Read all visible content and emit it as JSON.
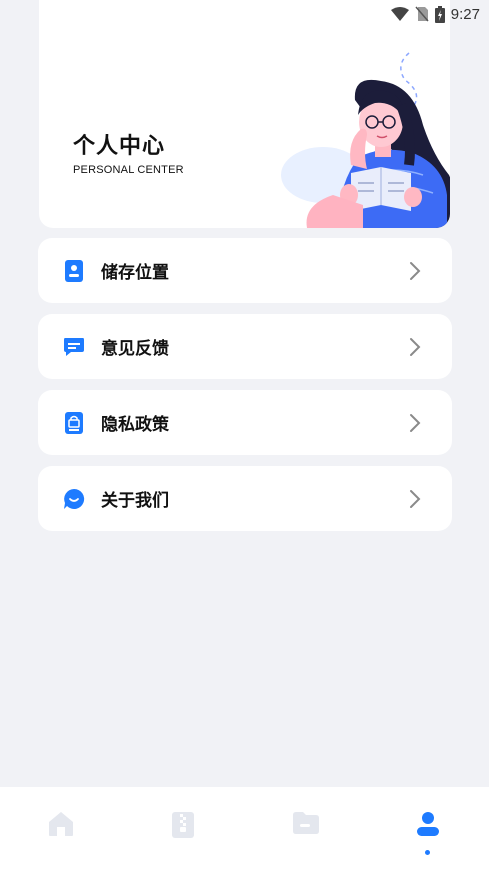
{
  "status_bar": {
    "time": "9:27",
    "icons": [
      "wifi-icon",
      "no-sim-icon",
      "battery-charging-icon"
    ]
  },
  "header": {
    "title": "个人中心",
    "subtitle": "PERSONAL CENTER"
  },
  "menu": {
    "items": [
      {
        "label": "储存位置",
        "icon": "storage-icon"
      },
      {
        "label": "意见反馈",
        "icon": "feedback-icon"
      },
      {
        "label": "隐私政策",
        "icon": "privacy-icon"
      },
      {
        "label": "关于我们",
        "icon": "about-icon"
      }
    ]
  },
  "tabbar": {
    "tabs": [
      {
        "icon": "home-icon",
        "active": false
      },
      {
        "icon": "file-icon",
        "active": false
      },
      {
        "icon": "folder-icon",
        "active": false
      },
      {
        "icon": "profile-icon",
        "active": true
      }
    ]
  },
  "colors": {
    "accent": "#1e7bff",
    "inactive": "#e4e7ee",
    "background": "#f1f2f6"
  }
}
